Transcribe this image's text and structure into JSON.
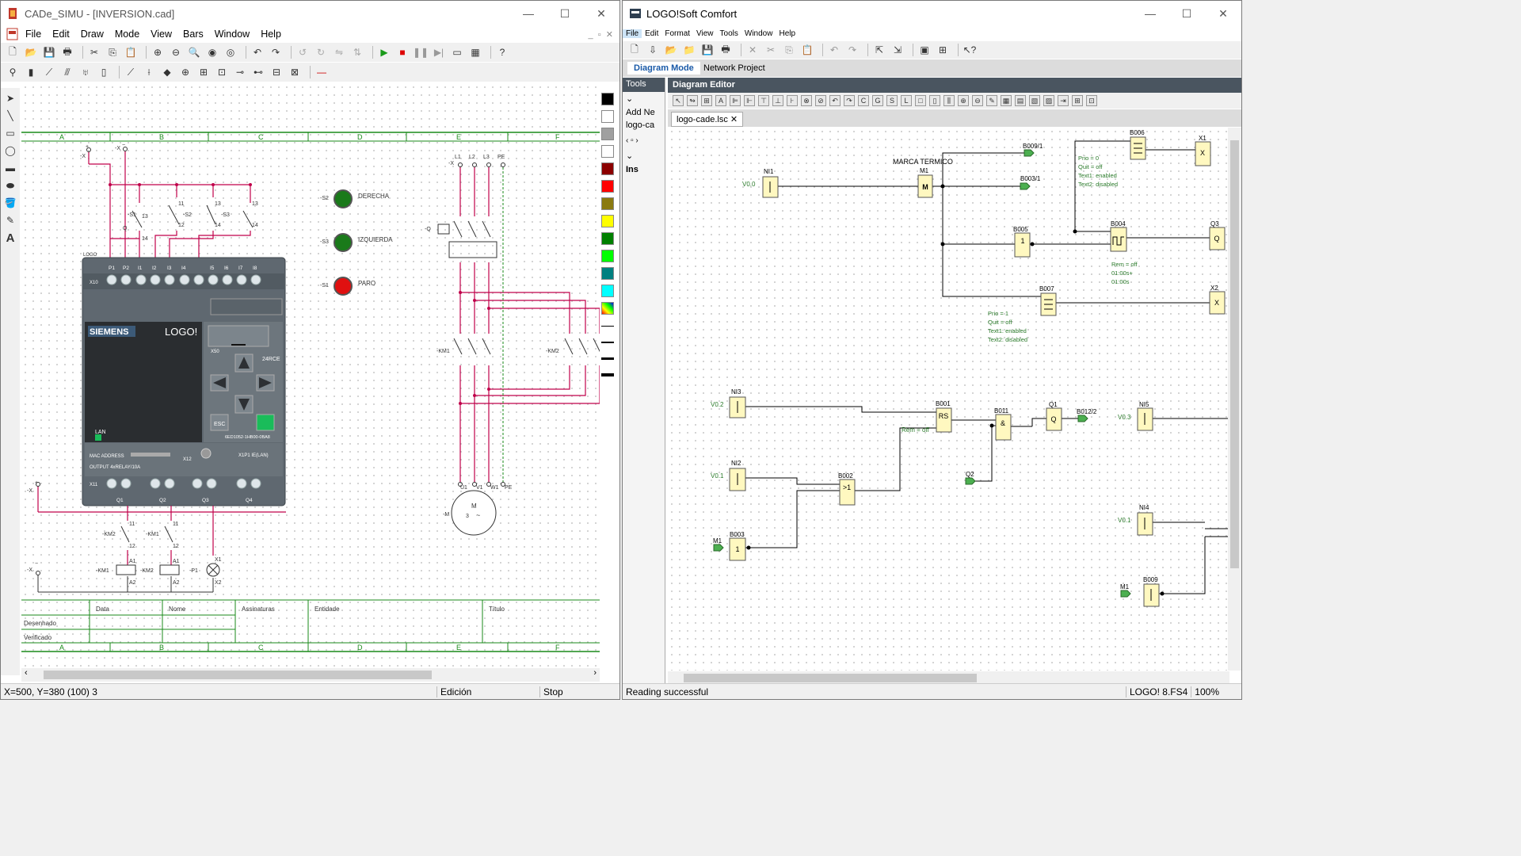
{
  "cade": {
    "title": "CADe_SIMU - [INVERSION.cad]",
    "menu": [
      "File",
      "Edit",
      "Draw",
      "Mode",
      "View",
      "Bars",
      "Window",
      "Help"
    ],
    "status": {
      "coords": "X=500, Y=380 (100) 3",
      "mode": "Edición",
      "run": "Stop"
    },
    "grid_cols": [
      "A",
      "B",
      "C",
      "D",
      "E",
      "F"
    ],
    "title_block": {
      "data": "Data",
      "nome": "Nome",
      "assinaturas": "Assinaturas",
      "entidade": "Entidade",
      "titulo": "Título",
      "desenhado": "Desenhado",
      "verificado": "Verificado"
    },
    "logo_device": {
      "brand": "SIEMENS",
      "model": "LOGO!",
      "variant": "24RCE",
      "esc": "ESC",
      "lan": "LAN",
      "part": "6ED1052-1HB00-0BA8",
      "mac": "MAC ADDRESS",
      "output": "OUTPUT 4xRELAY/10A",
      "label": "LOGO",
      "x10": "X10",
      "x50": "X50",
      "x11": "X11",
      "x12": "X12",
      "x1p1": "X1P1 IE(LAN)"
    },
    "inputs_top": [
      "P1",
      "P2",
      "I1",
      "I2",
      "I3",
      "I4",
      "I5",
      "I6",
      "I7",
      "I8"
    ],
    "outputs_bottom": [
      "Q1",
      "Q2",
      "Q3",
      "Q4"
    ],
    "pilots": [
      {
        "tag": "-S2",
        "label": "DERECHA",
        "color": "#1a7a1a"
      },
      {
        "tag": "-S3",
        "label": "IZQUIERDA",
        "color": "#1a7a1a"
      },
      {
        "tag": "-S1",
        "label": "PARO",
        "color": "#e01010"
      }
    ],
    "power_labels": [
      "L1",
      "L2",
      "L3",
      "PE"
    ],
    "motor_terminals": [
      "U1",
      "V1",
      "W1",
      "PE"
    ],
    "motor": "-M",
    "motor_text": "M\n3 ~",
    "tags": {
      "q": "-Q",
      "km1": "-KM1",
      "km2": "-KM2",
      "p1": "-P1",
      "x": "-X",
      "s1": "-S1",
      "s2": "-S2",
      "s3": "-S3",
      "q_ctrl": "Q"
    }
  },
  "logo": {
    "title": "LOGO!Soft Comfort",
    "menu": [
      "File",
      "Edit",
      "Format",
      "View",
      "Tools",
      "Window",
      "Help"
    ],
    "tabs": [
      "Diagram Mode",
      "Network Project"
    ],
    "panel_title": "Tools",
    "editor_title": "Diagram Editor",
    "doc_tab": "logo-cade.lsc",
    "tree": [
      "Add Ne",
      "logo-ca",
      "Ins"
    ],
    "status": {
      "msg": "Reading successful",
      "device": "LOGO! 8.FS4",
      "zoom": "100%"
    },
    "blocks": {
      "ni1": "NI1",
      "v00": "V0.0",
      "m1": "M1",
      "marca": "MARCA TERMICO",
      "b009_1": "B009/1",
      "b003_1": "B003/1",
      "b006": "B006",
      "x1": "X1",
      "b005": "B005",
      "b004": "B004",
      "q3": "Q3",
      "b007": "B007",
      "x2": "X2",
      "ni3": "NI3",
      "v02": "V0.2",
      "b001": "B001",
      "rs": "RS",
      "b011": "B011",
      "amp": "&",
      "q1": "Q1",
      "b012_2": "B012/2",
      "ni5": "NI5",
      "v03": "V0.3",
      "ni2": "NI2",
      "v01": "V0.1",
      "b002": "B002",
      "ge1": ">1",
      "q2": "Q2",
      "b003": "B003",
      "m1b": "M1",
      "ni4": "NI4",
      "v01b": "V0.1",
      "b009": "B009",
      "m1c": "M1",
      "remoff": "Rem = off",
      "q_glyph": "Q",
      "m_glyph": "M",
      "x_glyph": "X",
      "one": "1",
      "onb": "1"
    },
    "notes1": [
      "Prio = 0",
      "Quit = off",
      "Text1: enabled",
      "Text2: disabled"
    ],
    "notes2": [
      "Prio = 1",
      "Quit = off",
      "Text1: enabled",
      "Text2: disabled"
    ],
    "notes3": [
      "Rem = off",
      "01:00s+",
      "01:00s"
    ]
  }
}
